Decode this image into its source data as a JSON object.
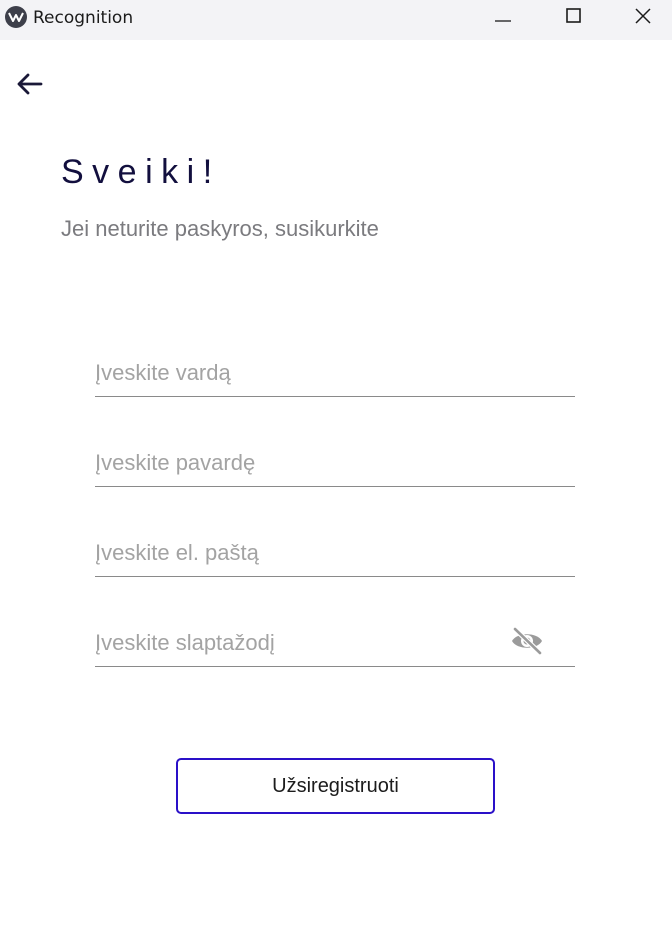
{
  "window": {
    "title": "Recognition",
    "controls": {
      "minimize_icon": "minimize-icon",
      "maximize_icon": "maximize-icon",
      "close_icon": "close-icon"
    }
  },
  "nav": {
    "back_icon": "arrow-left-icon"
  },
  "page": {
    "heading": "Sveiki!",
    "subheading": "Jei neturite paskyros, susikurkite"
  },
  "form": {
    "first_name": {
      "placeholder": "Įveskite vardą",
      "value": ""
    },
    "last_name": {
      "placeholder": "Įveskite pavardę",
      "value": ""
    },
    "email": {
      "placeholder": "Įveskite el. paštą",
      "value": ""
    },
    "password": {
      "placeholder": "Įveskite slaptažodį",
      "value": "",
      "toggle_icon": "eye-off-icon"
    },
    "submit_label": "Užsiregistruoti"
  },
  "colors": {
    "heading": "#120f3e",
    "button_border": "#2a10c8",
    "placeholder": "#a3a3a3",
    "titlebar": "#f3f3f6"
  }
}
